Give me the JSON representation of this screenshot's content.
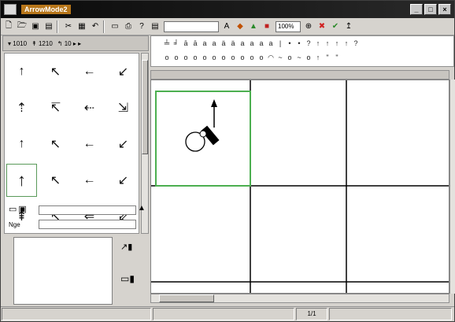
{
  "window": {
    "title": "ArrowMode2"
  },
  "titlebar_buttons": [
    "_",
    "□",
    "×"
  ],
  "toolbar": {
    "zoom_value": "100%"
  },
  "left_panel": {
    "tabs": [
      "▾ 1010",
      "↟ 1210",
      "↰ 10 ▸ ▸"
    ],
    "name_label": "Nge",
    "arrows": [
      [
        "↑",
        "↖",
        "←",
        "↙"
      ],
      [
        "⇡",
        "↸",
        "⇠",
        "⇲"
      ],
      [
        "↑",
        "↖",
        "←",
        "↙"
      ],
      [
        "↑",
        "↖",
        "←",
        "↙"
      ],
      [
        "⇞",
        "↸",
        "⇐",
        "⇙"
      ]
    ],
    "selected_index": [
      3,
      0
    ]
  },
  "symbols": {
    "row1": [
      "╧",
      "╛",
      "ā",
      "ā",
      "a",
      "a",
      "ä",
      "ä",
      "a",
      "a",
      "a",
      "a",
      "|",
      "•",
      "•",
      "?",
      "↑",
      "↑",
      "↑",
      "↑",
      "?"
    ],
    "row2": [
      "o",
      "o",
      "o",
      "o",
      "o",
      "o",
      "o",
      "o",
      "o",
      "o",
      "o",
      "◠",
      "~",
      "o",
      "~",
      "o",
      "↑",
      "\"",
      "\""
    ]
  },
  "status": {
    "panes": [
      "",
      "",
      "1/1",
      ""
    ]
  },
  "icons": {
    "app": "app-icon",
    "new": "new-file-icon",
    "open": "open-folder-icon",
    "save": "save-icon",
    "print": "print-icon",
    "undo": "undo-icon",
    "delete": "delete-icon",
    "paint": "paint-icon"
  }
}
